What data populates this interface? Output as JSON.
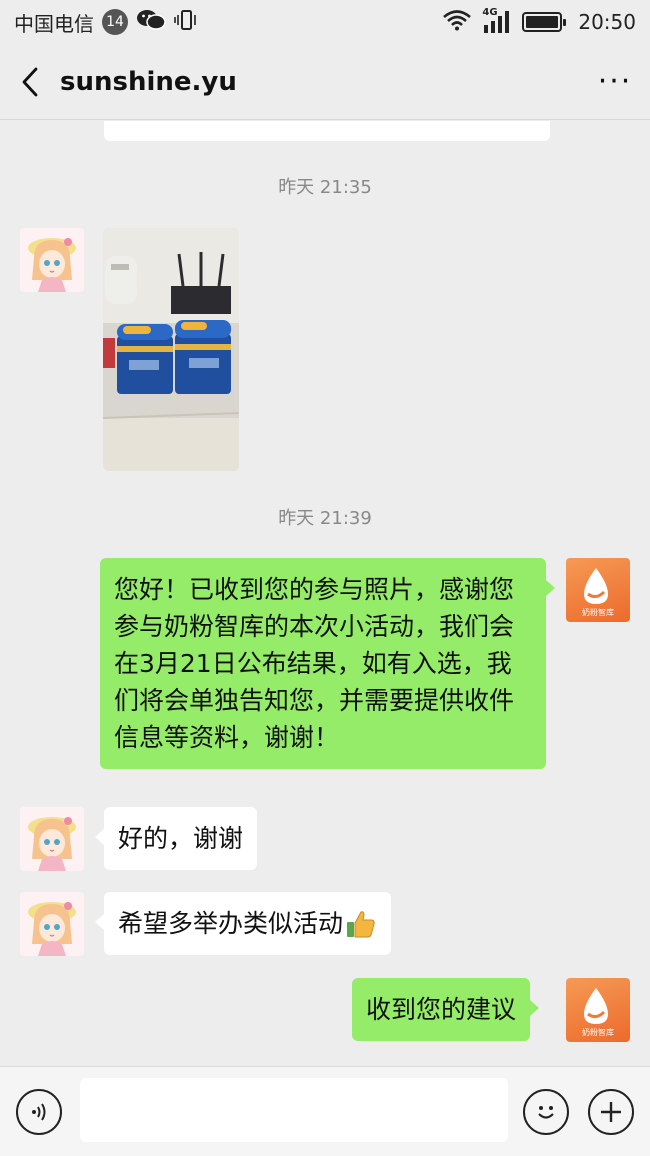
{
  "status_bar": {
    "carrier": "中国电信",
    "notification_count": "14",
    "network_type": "4G",
    "time": "20:50"
  },
  "header": {
    "title": "sunshine.yu",
    "more_label": "···"
  },
  "chat": {
    "timestamps": [
      "昨天 21:35",
      "昨天 21:39"
    ],
    "messages": [
      {
        "from": "other",
        "type": "image",
        "description": "photo of two formula milk cans"
      },
      {
        "from": "me",
        "type": "text",
        "text": "您好！已收到您的参与照片，感谢您参与奶粉智库的本次小活动，我们会在3月21日公布结果，如有入选，我们将会单独告知您，并需要提供收件信息等资料，谢谢！"
      },
      {
        "from": "other",
        "type": "text",
        "text": "好的，谢谢"
      },
      {
        "from": "other",
        "type": "text",
        "text": "希望多举办类似活动",
        "emoji": "thumbs-up-icon"
      },
      {
        "from": "me",
        "type": "text",
        "text": "收到您的建议"
      }
    ]
  },
  "avatars": {
    "other": "anime-girl-avatar",
    "me": "奶粉智库"
  },
  "input_bar": {
    "value": "",
    "placeholder": ""
  },
  "colors": {
    "background": "#ededed",
    "outgoing_bubble": "#95ec69",
    "incoming_bubble": "#ffffff",
    "brand_orange": "#f0783a"
  }
}
